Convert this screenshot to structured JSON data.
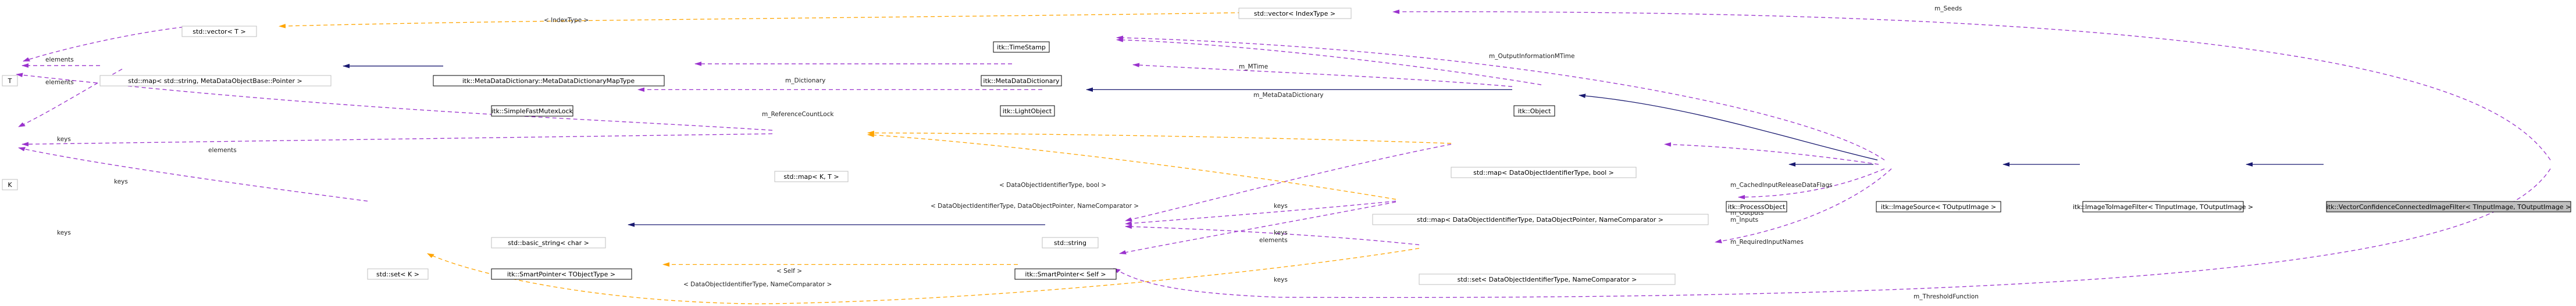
{
  "colors": {
    "inheritance": "#191970",
    "usage": "#9a32cd",
    "template": "#ffa500",
    "focus_fill": "#bfbfbf",
    "grey_border": "#bfbfbf"
  },
  "nodes": {
    "focus": "itk::VectorConfidenceConnectedImageFilter< TInputImage, TOutputImage >",
    "image_to_image_filter": "itk::ImageToImageFilter< TInputImage, TOutputImage >",
    "image_source": "itk::ImageSource< TOutputImage >",
    "process_object": "itk::ProcessObject",
    "object": "itk::Object",
    "light_object": "itk::LightObject",
    "simple_fast_mutex_lock": "itk::SimpleFastMutexLock",
    "time_stamp": "itk::TimeStamp",
    "meta_data_dictionary": "itk::MetaDataDictionary",
    "meta_data_dictionary_map_type": "itk::MetaDataDictionary::MetaDataDictionaryMapType",
    "map_string_meta": "std::map< std::string, MetaDataObjectBase::Pointer >",
    "t_node": "T",
    "k_node": "K",
    "vector_t": "std::vector< T >",
    "vector_index": "std::vector< IndexType >",
    "map_kt": "std::map< K, T >",
    "map_bool": "std::map< DataObjectIdentifierType, bool >",
    "map_dataobj": "std::map< DataObjectIdentifierType, DataObjectPointer, NameComparator >",
    "basic_string": "std::basic_string< char >",
    "std_string": "std::string",
    "smart_pointer_self": "itk::SmartPointer< Self >",
    "smart_pointer_tobject": "itk::SmartPointer< TObjectType >",
    "set_k": "std::set< K >",
    "set_dataobj": "std::set< DataObjectIdentifierType, NameComparator >"
  },
  "edge_labels": {
    "seeds": "m_Seeds",
    "index_type": "< IndexType >",
    "output_info_mtime": "m_OutputInformationMTime",
    "mtime": "m_MTime",
    "meta_data_dictionary": "m_MetaDataDictionary",
    "dictionary": "m_Dictionary",
    "reference_count_lock": "m_ReferenceCountLock",
    "elements_vec": "elements",
    "elements_map": "elements",
    "keys_map": "keys",
    "elements_lower": "elements",
    "keys_lower": "keys",
    "keys_set": "keys",
    "tmpl_bool": "< DataObjectIdentifierType, bool >",
    "tmpl_dataobj": "< DataObjectIdentifierType, DataObjectPointer, NameComparator >",
    "cached_input": "m_CachedInputReleaseDataFlags",
    "outputs_inputs": "m_Outputs\nm_Inputs",
    "keys_str1": "keys",
    "keys_str2": "keys",
    "elements_sp": "elements",
    "required_input": "m_RequiredInputNames",
    "keys_set2": "keys",
    "self": "< Self >",
    "tmpl_set": "< DataObjectIdentifierType, NameComparator >",
    "threshold_function": "m_ThresholdFunction"
  }
}
